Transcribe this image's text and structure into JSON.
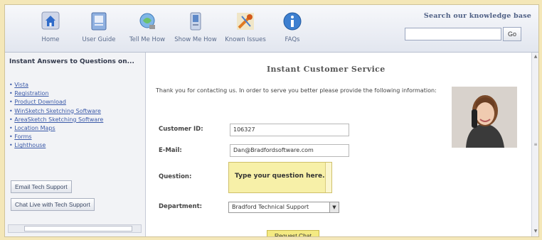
{
  "toolbar": {
    "items": [
      {
        "label": "Home",
        "icon": "home-icon"
      },
      {
        "label": "User Guide",
        "icon": "guide-icon"
      },
      {
        "label": "Tell Me How",
        "icon": "tell-me-how-icon"
      },
      {
        "label": "Show Me How",
        "icon": "show-me-how-icon"
      },
      {
        "label": "Known Issues",
        "icon": "known-issues-icon"
      },
      {
        "label": "FAQs",
        "icon": "faqs-icon"
      }
    ]
  },
  "search": {
    "title": "Search our knowledge base",
    "placeholder": "",
    "button": "Go"
  },
  "sidebar": {
    "heading": "Instant Answers to Questions on...",
    "links": [
      "Vista",
      "Registration",
      "Product Download",
      "WinSketch Sketching Software",
      "AreaSketch Sketching Software",
      "Location Maps",
      "Forms",
      "Lighthouse"
    ],
    "email_button": "Email Tech Support",
    "chat_button": "Chat Live with Tech Support"
  },
  "main": {
    "title": "Instant Customer Service",
    "intro": "Thank you for contacting us. In order to serve you better please provide the following information:",
    "form": {
      "customer_id_label": "Customer ID:",
      "customer_id_value": "106327",
      "email_label": "E-Mail:",
      "email_value": "Dan@Bradfordsoftware.com",
      "question_label": "Question:",
      "question_placeholder": "Type your question here.",
      "department_label": "Department:",
      "department_value": "Bradford Technical Support",
      "submit_label": "Request Chat"
    }
  },
  "colors": {
    "frame_bg": "#f4e7b8",
    "link": "#3a59a8",
    "question_bg": "#f7f0a8",
    "button_bg": "#f4ea82"
  }
}
